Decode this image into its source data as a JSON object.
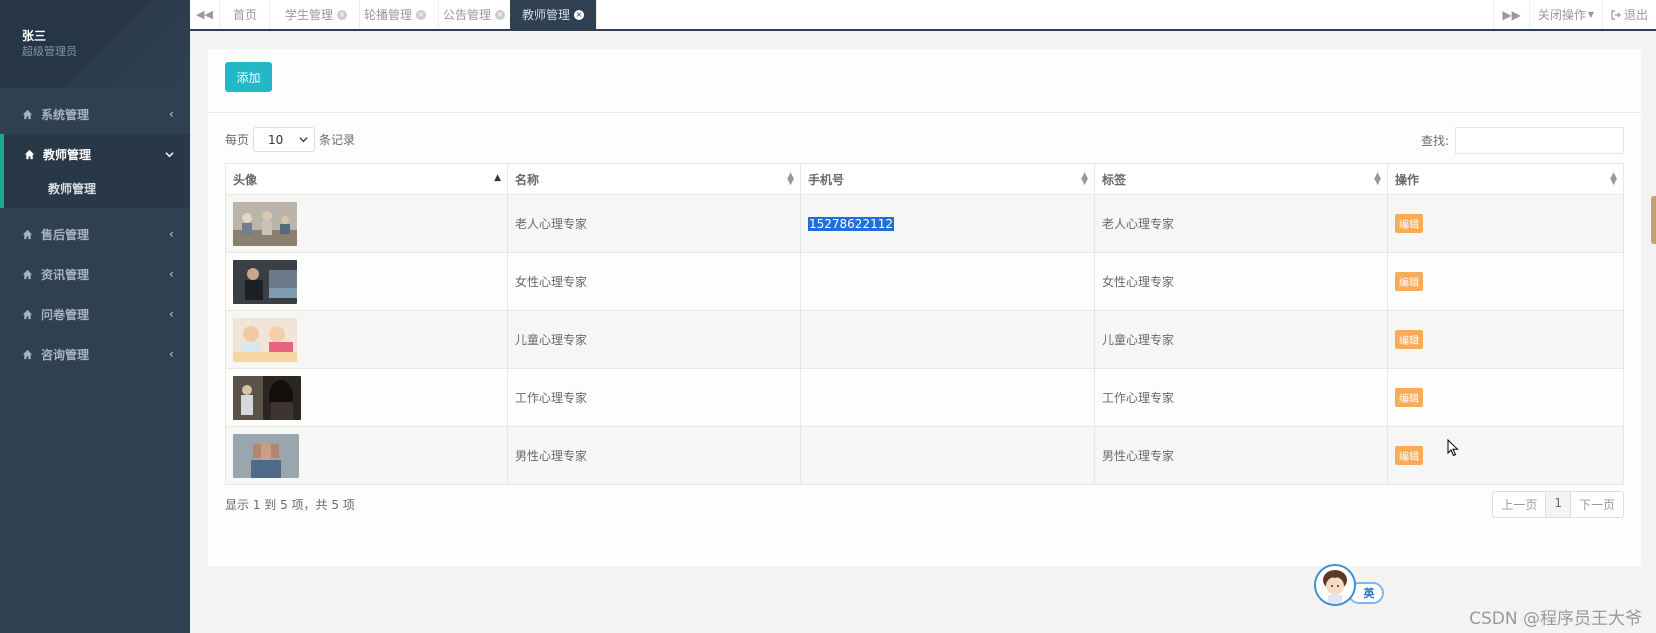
{
  "sidebar": {
    "user_name": "张三",
    "user_role": "超级管理员",
    "items": [
      {
        "label": "系统管理"
      },
      {
        "label": "教师管理"
      },
      {
        "label": "售后管理"
      },
      {
        "label": "资讯管理"
      },
      {
        "label": "问卷管理"
      },
      {
        "label": "咨询管理"
      }
    ],
    "submenu_item": "教师管理",
    "accent_color": "#19aa8d"
  },
  "tabs": {
    "items": [
      {
        "label": "首页"
      },
      {
        "label": "学生管理"
      },
      {
        "label": "轮播管理"
      },
      {
        "label": "公告管理"
      },
      {
        "label": "教师管理"
      }
    ],
    "active_index": 4,
    "close_ops": "关闭操作",
    "logout": "退出"
  },
  "toolbar": {
    "add_label": "添加"
  },
  "table_controls": {
    "per_page_prefix": "每页",
    "per_page_value": "10",
    "per_page_suffix": "条记录",
    "search_label": "查找:"
  },
  "table": {
    "headers": [
      "头像",
      "名称",
      "手机号",
      "标签",
      "操作"
    ],
    "rows": [
      {
        "name": "老人心理专家",
        "phone": "15278622112",
        "tag": "老人心理专家",
        "action": "编辑"
      },
      {
        "name": "女性心理专家",
        "phone": "",
        "tag": "女性心理专家",
        "action": "编辑"
      },
      {
        "name": "儿童心理专家",
        "phone": "",
        "tag": "儿童心理专家",
        "action": "编辑"
      },
      {
        "name": "工作心理专家",
        "phone": "",
        "tag": "工作心理专家",
        "action": "编辑"
      },
      {
        "name": "男性心理专家",
        "phone": "",
        "tag": "男性心理专家",
        "action": "编辑"
      }
    ]
  },
  "pagination": {
    "info": "显示 1 到 5 项，共 5 项",
    "prev": "上一页",
    "current": "1",
    "next": "下一页"
  },
  "widget": {
    "lang": "英"
  },
  "watermark": "CSDN @程序员王大爷"
}
